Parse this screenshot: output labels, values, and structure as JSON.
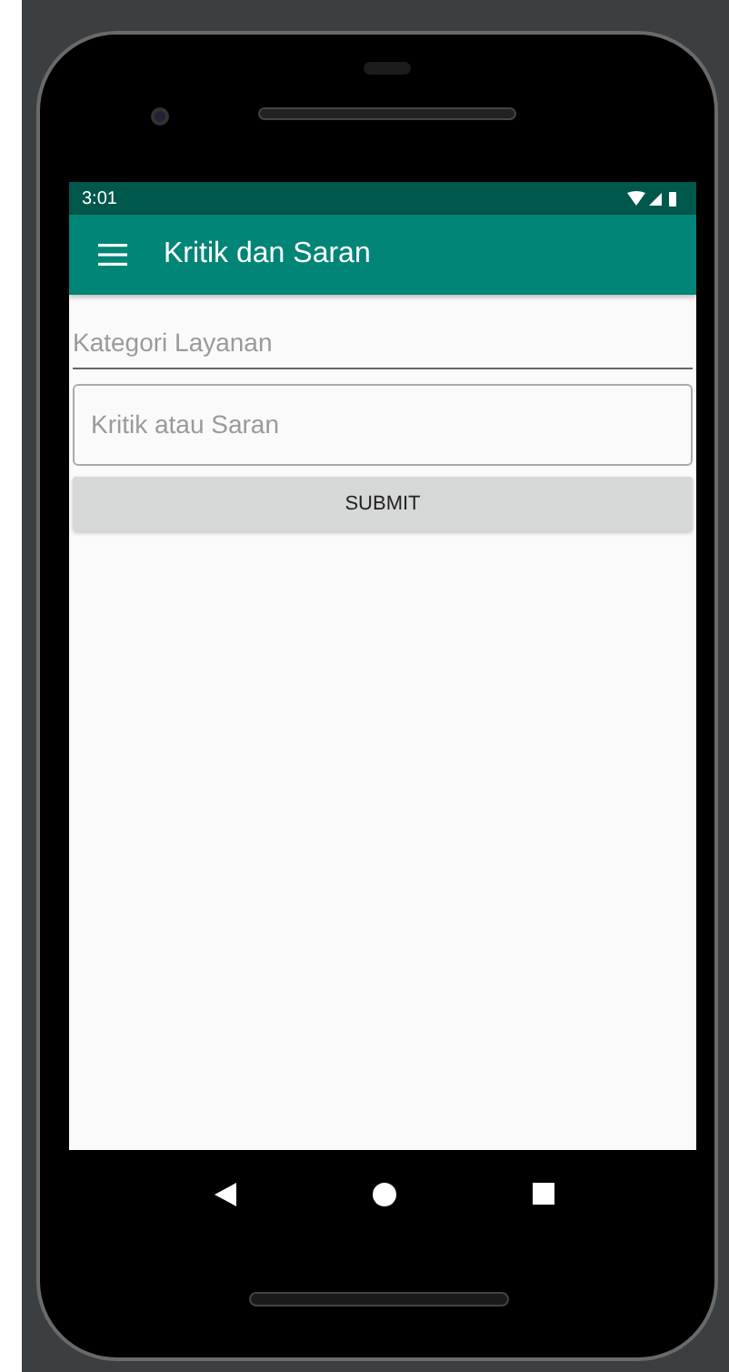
{
  "status_bar": {
    "time": "3:01"
  },
  "app_bar": {
    "title": "Kritik dan Saran"
  },
  "fields": [
    {
      "kind": "underline",
      "placeholder": "Kategori Layanan"
    },
    {
      "kind": "outlined",
      "placeholder": "Kritik atau Saran"
    }
  ],
  "submit_button": {
    "label": "SUBMIT"
  }
}
